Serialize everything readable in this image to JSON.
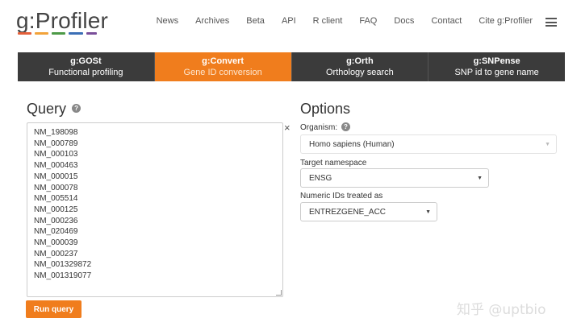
{
  "header": {
    "logo": "g:Profiler",
    "logo_colors": [
      "#e45f3a",
      "#f2a33a",
      "#4d9a47",
      "#3b6fb6",
      "#7a4f9a"
    ],
    "nav": [
      "News",
      "Archives",
      "Beta",
      "API",
      "R client",
      "FAQ",
      "Docs",
      "Contact",
      "Cite g:Profiler"
    ]
  },
  "tabs": [
    {
      "title": "g:GOSt",
      "subtitle": "Functional profiling"
    },
    {
      "title": "g:Convert",
      "subtitle": "Gene ID conversion"
    },
    {
      "title": "g:Orth",
      "subtitle": "Orthology search"
    },
    {
      "title": "g:SNPense",
      "subtitle": "SNP id to gene name"
    }
  ],
  "active_tab": "g:Convert",
  "accent_color": "#f07d1d",
  "query": {
    "title": "Query",
    "ids": [
      "NM_198098",
      "NM_000789",
      "NM_000103",
      "NM_000463",
      "NM_000015",
      "NM_000078",
      "NM_005514",
      "NM_000125",
      "NM_000236",
      "NM_020469",
      "NM_000039",
      "NM_000237",
      "NM_001329872",
      "NM_001319077"
    ],
    "clear": "×",
    "run_label": "Run query"
  },
  "options": {
    "title": "Options",
    "organism_label": "Organism:",
    "organism_value": "Homo sapiens (Human)",
    "target_label": "Target namespace",
    "target_value": "ENSG",
    "numeric_label": "Numeric IDs treated as",
    "numeric_value": "ENTREZGENE_ACC"
  },
  "watermark": "知乎 @uptbio"
}
